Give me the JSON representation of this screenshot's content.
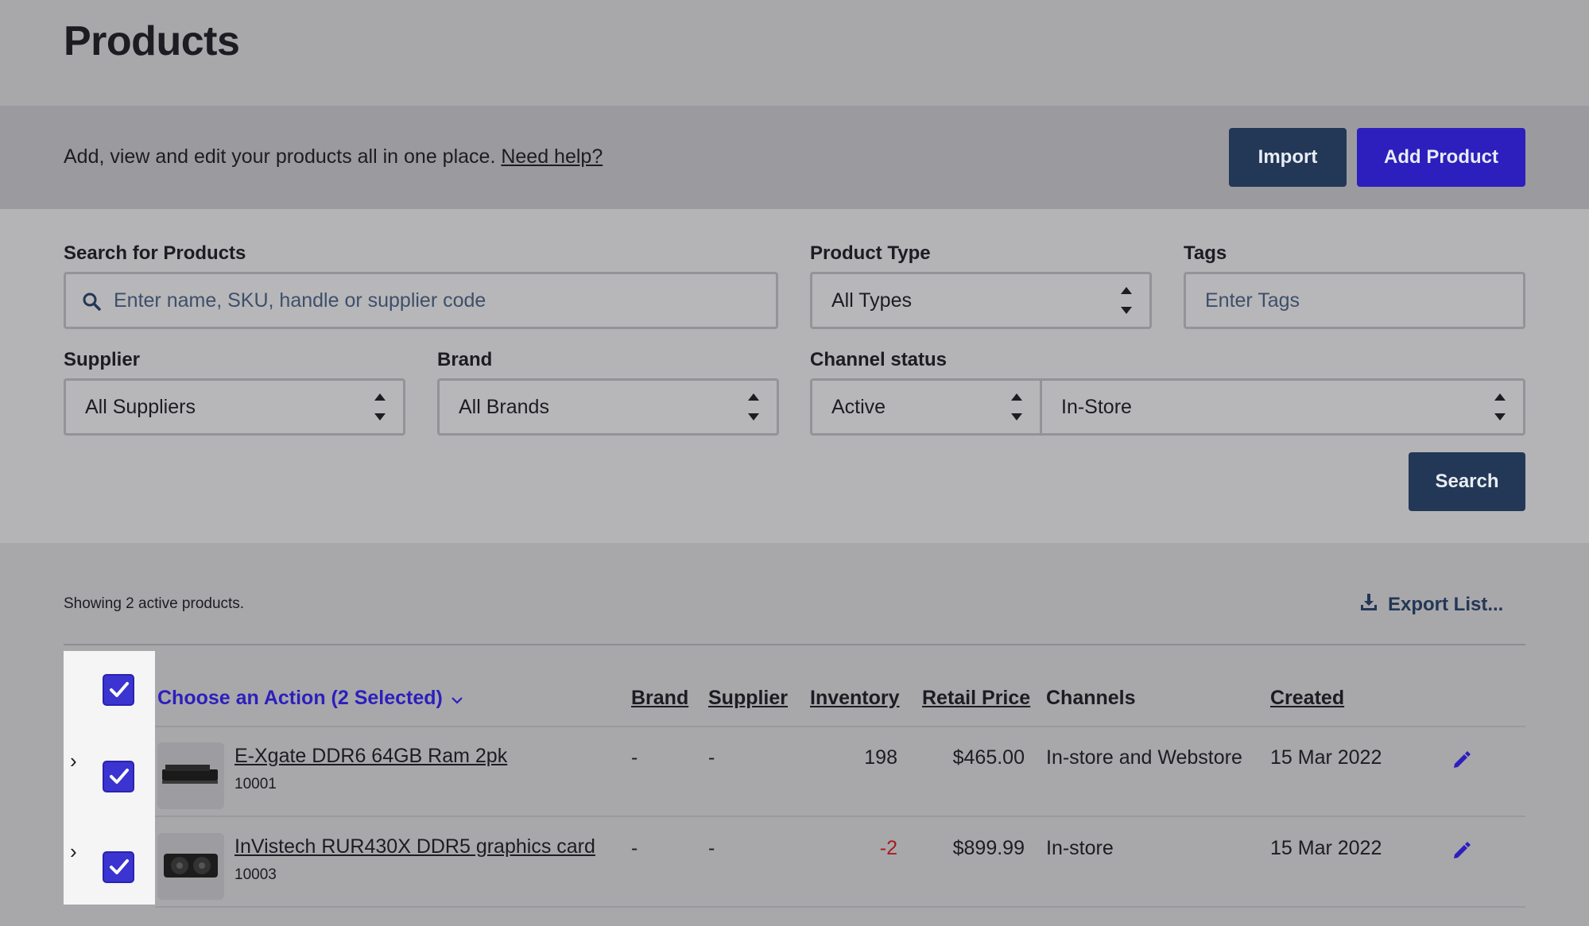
{
  "page": {
    "title": "Products"
  },
  "banner": {
    "text": "Add, view and edit your products all in one place.",
    "help_link": "Need help?",
    "import_label": "Import",
    "add_label": "Add Product"
  },
  "filters": {
    "search": {
      "label": "Search for Products",
      "placeholder": "Enter name, SKU, handle or supplier code"
    },
    "product_type": {
      "label": "Product Type",
      "value": "All Types"
    },
    "tags": {
      "label": "Tags",
      "placeholder": "Enter Tags"
    },
    "supplier": {
      "label": "Supplier",
      "value": "All Suppliers"
    },
    "brand": {
      "label": "Brand",
      "value": "All Brands"
    },
    "channel_status": {
      "label": "Channel status",
      "status": "Active",
      "channel": "In-Store"
    },
    "search_button": "Search"
  },
  "results": {
    "summary": "Showing 2 active products.",
    "export_label": "Export List...",
    "action_label": "Choose an Action (2 Selected)",
    "columns": {
      "brand": "Brand",
      "supplier": "Supplier",
      "inventory": "Inventory",
      "retail_price": "Retail Price",
      "channels": "Channels",
      "created": "Created"
    },
    "rows": [
      {
        "name": "E-Xgate DDR6 64GB Ram 2pk",
        "sku": "10001",
        "brand": "-",
        "supplier": "-",
        "inventory": "198",
        "price": "$465.00",
        "channels": "In-store and Webstore",
        "created": "15 Mar 2022"
      },
      {
        "name": "InVistech RUR430X DDR5 graphics card",
        "sku": "10003",
        "brand": "-",
        "supplier": "-",
        "inventory": "-2",
        "price": "$899.99",
        "channels": "In-store",
        "created": "15 Mar 2022"
      }
    ]
  },
  "colors": {
    "primary": "#2c1fbd",
    "dark_button": "#233756",
    "negative": "#a61c1c",
    "checkbox": "#3b34d0"
  },
  "icons": [
    "search-icon",
    "chevron-up-down-icon",
    "download-icon",
    "chevron-down-icon",
    "chevron-right-icon",
    "check-icon",
    "pencil-icon"
  ]
}
